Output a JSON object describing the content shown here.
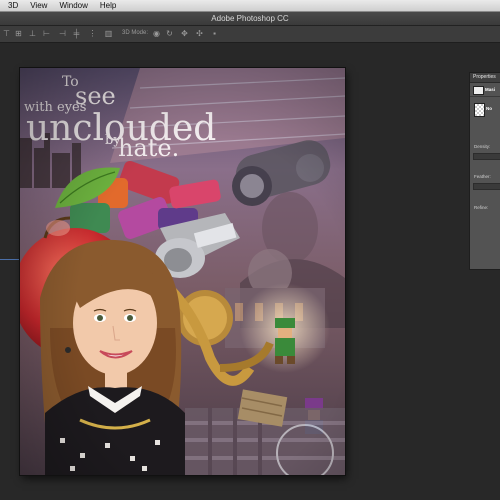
{
  "menubar": {
    "items": [
      "3D",
      "View",
      "Window",
      "Help"
    ]
  },
  "window": {
    "title": "Adobe Photoshop CC"
  },
  "optionsbar": {
    "mode_label": "3D Mode:"
  },
  "artwork": {
    "line1": "To",
    "line2": "see",
    "line3": "with eyes",
    "line4": "unclouded",
    "line5": "by",
    "line6": "hate."
  },
  "properties_panel": {
    "title": "Properties",
    "row1_label": "Masi",
    "row2_label": "No",
    "density_label": "Density:",
    "feather_label": "Feather:",
    "refine_label": "Refine:"
  },
  "colors": {
    "panel_bg": "#535353",
    "workspace_bg": "#282828",
    "guide": "#4b6fa8"
  }
}
